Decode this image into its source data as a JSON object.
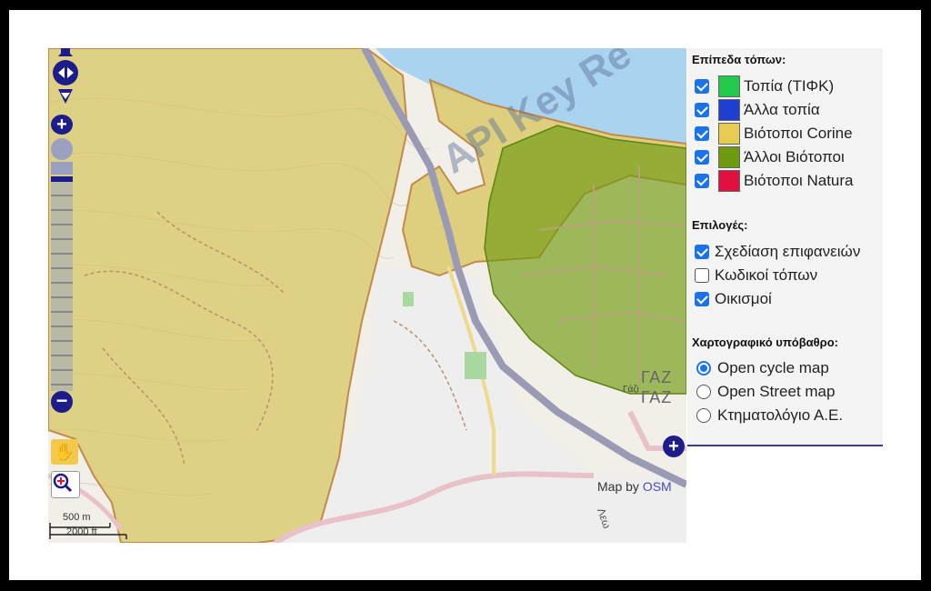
{
  "colors": {
    "tifk": "#22c94a",
    "other_landscapes": "#1f3fd1",
    "corine": "#e6cc52",
    "other_habitats": "#6e9a10",
    "natura": "#e0103f",
    "water": "#aad3f0",
    "checkbox_accent": "#1a73e8"
  },
  "map": {
    "watermark": "API Key Re",
    "attribution_prefix": "Map by ",
    "attribution_link": "OSM",
    "scale_top": "500 m",
    "scale_bottom": "2000 ft",
    "town_label_1": "ΓΑΖ",
    "town_label_2": "ΓΑΖ",
    "town_small_label": "Γάζι",
    "road_label": "Λεω",
    "controls": {
      "pan_icon": "pan-arrows-icon",
      "zoom_in": "+",
      "zoom_out": "−",
      "zoom_world_icon": "globe-icon",
      "hand_icon": "hand-pan-icon",
      "zoom_box_icon": "zoom-box-icon",
      "expand_icon": "plus-circle-icon"
    }
  },
  "panel": {
    "layers_title": "Επίπεδα τόπων:",
    "layers": [
      {
        "label": "Τοπία (ΤΙΦΚ)",
        "checked": true,
        "color": "#22c94a"
      },
      {
        "label": "Άλλα τοπία",
        "checked": true,
        "color": "#1f3fd1"
      },
      {
        "label": "Βιότοποι Corine",
        "checked": true,
        "color": "#e6cc52"
      },
      {
        "label": "Άλλοι Βιότοποι",
        "checked": true,
        "color": "#6e9a10"
      },
      {
        "label": "Βιότοποι Natura",
        "checked": true,
        "color": "#e0103f"
      }
    ],
    "options_title": "Επιλογές:",
    "options": [
      {
        "label": "Σχεδίαση επιφανειών",
        "checked": true
      },
      {
        "label": "Κωδικοί τόπων",
        "checked": false
      },
      {
        "label": "Οικισμοί",
        "checked": true
      }
    ],
    "basemap_title": "Χαρτογραφικό υπόβαθρο:",
    "basemaps": [
      {
        "label": "Open cycle map",
        "selected": true
      },
      {
        "label": "Open Street map",
        "selected": false
      },
      {
        "label": "Κτηματολόγιο Α.Ε.",
        "selected": false
      }
    ]
  }
}
